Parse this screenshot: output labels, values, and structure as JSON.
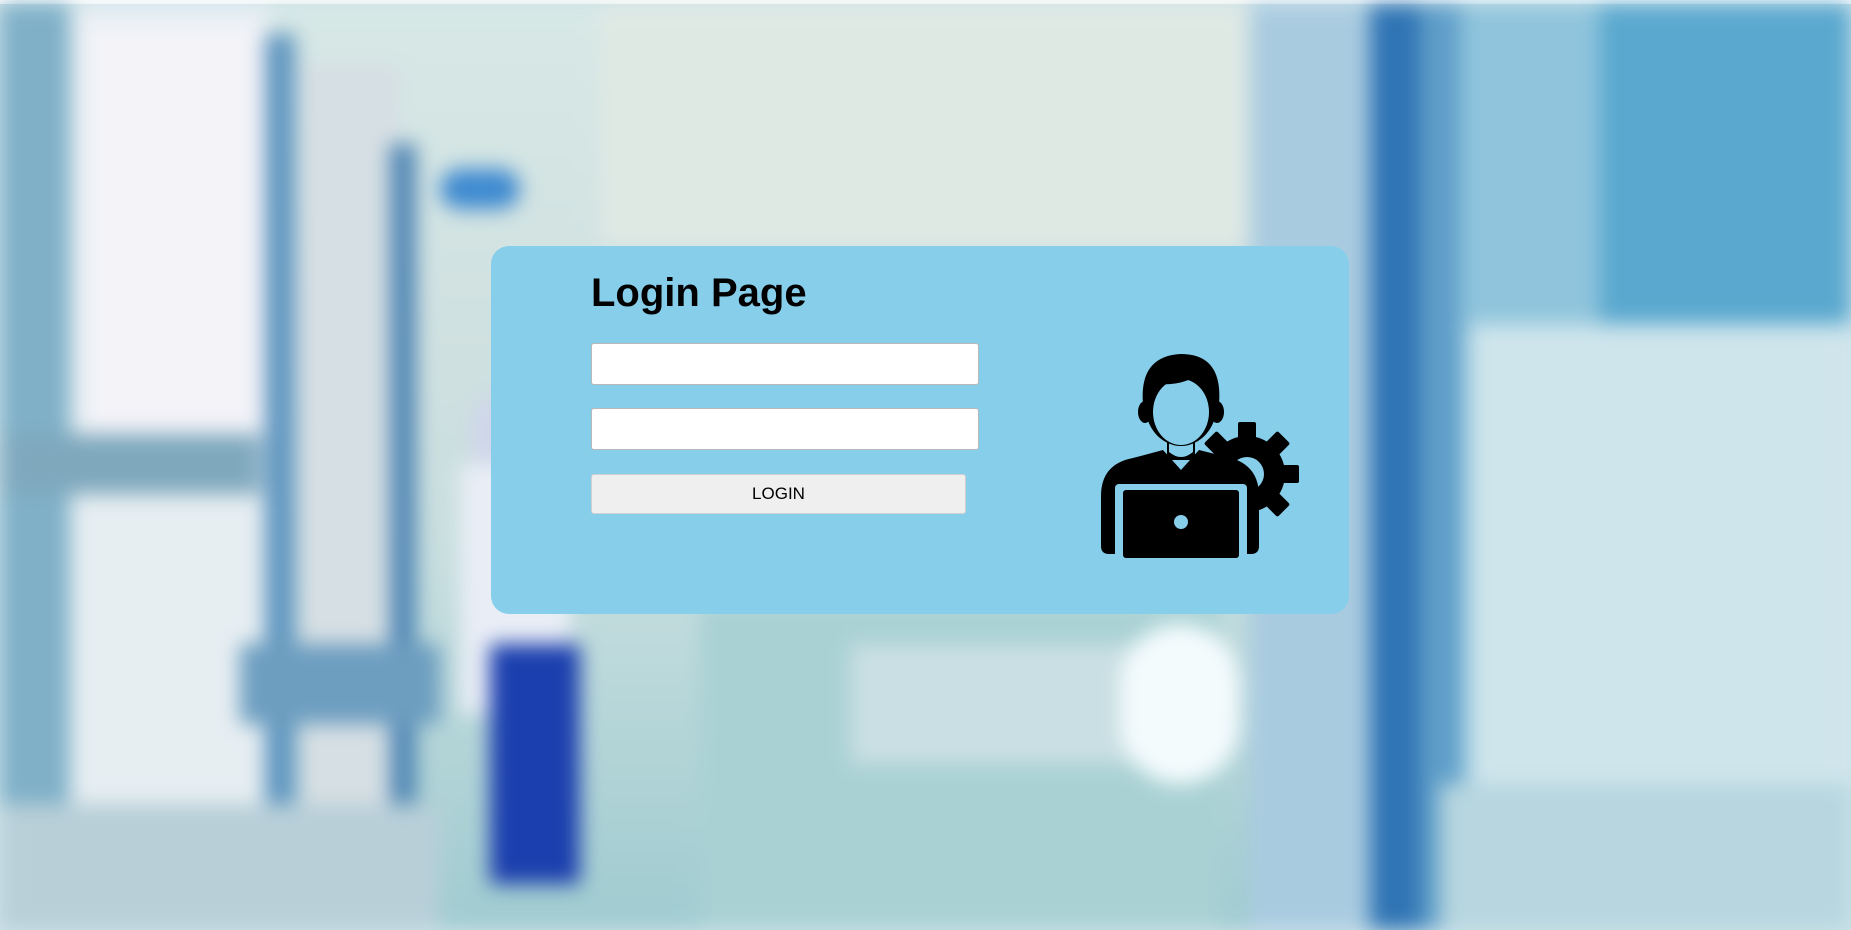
{
  "login": {
    "title": "Login Page",
    "username_value": "",
    "password_value": "",
    "button_label": "LOGIN"
  },
  "icons": {
    "illustration": "user-with-laptop-and-gear-icon"
  },
  "colors": {
    "card_background": "#87ceeb",
    "button_background": "#efefef",
    "field_background": "#ffffff",
    "text": "#000000"
  }
}
